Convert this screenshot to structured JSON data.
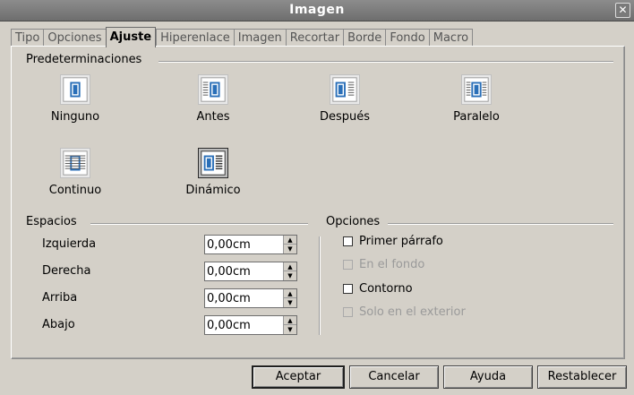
{
  "window": {
    "title": "Imagen",
    "close_glyph": "✕"
  },
  "tabs": [
    {
      "label": "Tipo",
      "active": false
    },
    {
      "label": "Opciones",
      "active": false
    },
    {
      "label": "Ajuste",
      "active": true
    },
    {
      "label": "Hiperenlace",
      "active": false
    },
    {
      "label": "Imagen",
      "active": false
    },
    {
      "label": "Recortar",
      "active": false
    },
    {
      "label": "Borde",
      "active": false
    },
    {
      "label": "Fondo",
      "active": false
    },
    {
      "label": "Macro",
      "active": false
    }
  ],
  "predeterminaciones": {
    "title": "Predeterminaciones",
    "options": [
      {
        "label": "Ninguno",
        "icon": "wrap-none-icon",
        "selected": false
      },
      {
        "label": "Antes",
        "icon": "wrap-before-icon",
        "selected": false
      },
      {
        "label": "Después",
        "icon": "wrap-after-icon",
        "selected": false
      },
      {
        "label": "Paralelo",
        "icon": "wrap-parallel-icon",
        "selected": false
      },
      {
        "label": "Continuo",
        "icon": "wrap-through-icon",
        "selected": false
      },
      {
        "label": "Dinámico",
        "icon": "wrap-optimal-icon",
        "selected": true
      }
    ]
  },
  "espacios": {
    "title": "Espacios",
    "fields": [
      {
        "label": "Izquierda",
        "value": "0,00cm"
      },
      {
        "label": "Derecha",
        "value": "0,00cm"
      },
      {
        "label": "Arriba",
        "value": "0,00cm"
      },
      {
        "label": "Abajo",
        "value": "0,00cm"
      }
    ]
  },
  "opciones": {
    "title": "Opciones",
    "checks": [
      {
        "label": "Primer párrafo",
        "checked": false,
        "enabled": true
      },
      {
        "label": "En el fondo",
        "checked": false,
        "enabled": false
      },
      {
        "label": "Contorno",
        "checked": false,
        "enabled": true
      },
      {
        "label": "Solo en el exterior",
        "checked": false,
        "enabled": false
      }
    ]
  },
  "buttons": {
    "accept": "Aceptar",
    "cancel": "Cancelar",
    "help": "Ayuda",
    "reset": "Restablecer"
  }
}
